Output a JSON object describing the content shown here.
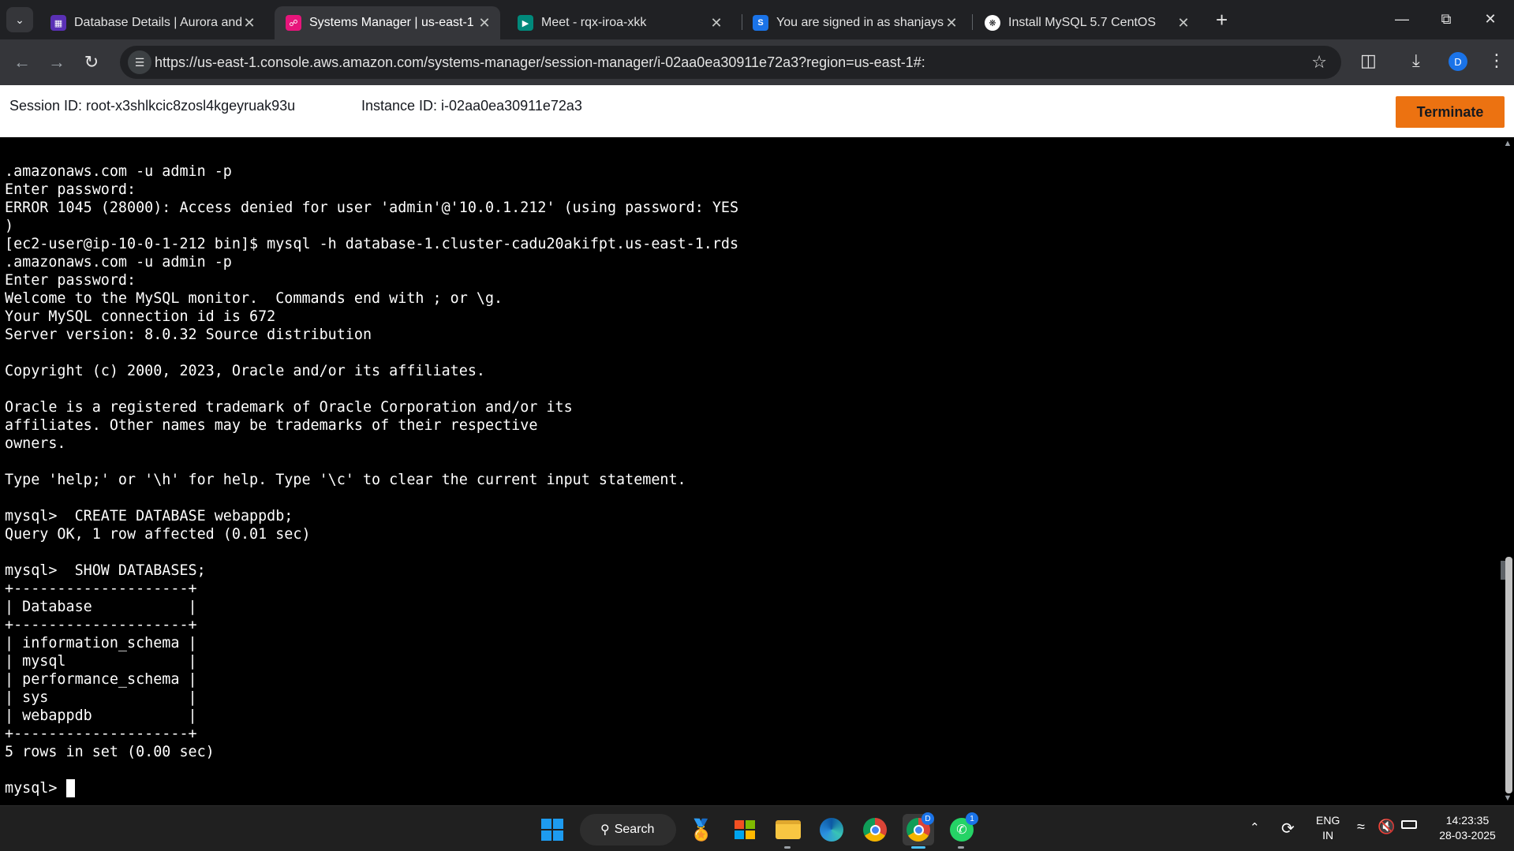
{
  "browser": {
    "tabs": [
      {
        "title": "Database Details | Aurora and R",
        "favicon": "rds-icon",
        "color": "#5a30b5"
      },
      {
        "title": "Systems Manager | us-east-1",
        "favicon": "systems-manager-icon",
        "color": "#e7157b"
      },
      {
        "title": "Meet - rqx-iroa-xkk",
        "favicon": "google-meet-icon",
        "color": "#00897b"
      },
      {
        "title": "You are signed in as shanjaysb",
        "favicon": "s-icon",
        "color": "#1a73e8"
      },
      {
        "title": "Install MySQL 5.7 CentOS",
        "favicon": "openai-icon",
        "color": "#ffffff"
      }
    ],
    "url": "https://us-east-1.console.aws.amazon.com/systems-manager/session-manager/i-02aa0ea30911e72a3?region=us-east-1#:",
    "profile_initial": "D"
  },
  "session": {
    "session_id": "Session ID: root-x3shlkcic8zosl4kgeyruak93u",
    "instance_id": "Instance ID: i-02aa0ea30911e72a3",
    "terminate_label": "Terminate"
  },
  "terminal": {
    "lines": [
      ".amazonaws.com -u admin -p",
      "Enter password:",
      "ERROR 1045 (28000): Access denied for user 'admin'@'10.0.1.212' (using password: YES",
      ")",
      "[ec2-user@ip-10-0-1-212 bin]$ mysql -h database-1.cluster-cadu20akifpt.us-east-1.rds",
      ".amazonaws.com -u admin -p",
      "Enter password:",
      "Welcome to the MySQL monitor.  Commands end with ; or \\g.",
      "Your MySQL connection id is 672",
      "Server version: 8.0.32 Source distribution",
      "",
      "Copyright (c) 2000, 2023, Oracle and/or its affiliates.",
      "",
      "Oracle is a registered trademark of Oracle Corporation and/or its",
      "affiliates. Other names may be trademarks of their respective",
      "owners.",
      "",
      "Type 'help;' or '\\h' for help. Type '\\c' to clear the current input statement.",
      "",
      "mysql>  CREATE DATABASE webappdb;",
      "Query OK, 1 row affected (0.01 sec)",
      "",
      "mysql>  SHOW DATABASES;",
      "+--------------------+",
      "| Database           |",
      "+--------------------+",
      "| information_schema |",
      "| mysql              |",
      "| performance_schema |",
      "| sys                |",
      "| webappdb           |",
      "+--------------------+",
      "5 rows in set (0.00 sec)",
      ""
    ],
    "prompt": "mysql> "
  },
  "taskbar": {
    "search_label": "Search",
    "language": "ENG",
    "region": "IN",
    "time": "14:23:35",
    "date": "28-03-2025",
    "chrome_badge": "D",
    "whatsapp_badge": "1"
  }
}
